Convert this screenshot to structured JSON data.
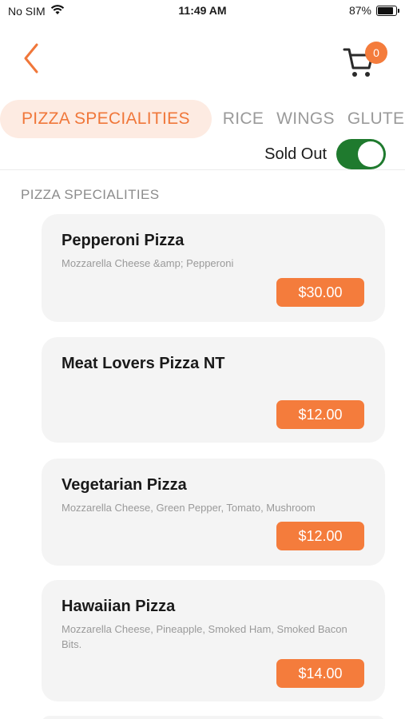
{
  "status_bar": {
    "carrier": "No SIM",
    "time": "11:49 AM",
    "battery_percent": "87%",
    "battery_level": 0.87
  },
  "nav": {
    "back_icon": "chevron-left-icon",
    "cart_icon": "shopping-cart-icon",
    "cart_count": "0"
  },
  "tabs": [
    {
      "label": "PIZZA SPECIALITIES",
      "active": true
    },
    {
      "label": "RICE",
      "active": false
    },
    {
      "label": "WINGS",
      "active": false
    },
    {
      "label": "GLUTEN",
      "active": false
    }
  ],
  "sold_out": {
    "label": "Sold Out",
    "enabled": true
  },
  "section": {
    "title": "PIZZA SPECIALITIES"
  },
  "items": [
    {
      "name": "Pepperoni Pizza",
      "description": "Mozzarella Cheese &amp; Pepperoni",
      "price": "$30.00"
    },
    {
      "name": "Meat Lovers Pizza NT",
      "description": "",
      "price": "$12.00"
    },
    {
      "name": "Vegetarian Pizza",
      "description": "Mozzarella Cheese, Green Pepper, Tomato, Mushroom",
      "price": "$12.00"
    },
    {
      "name": "Hawaiian Pizza",
      "description": "Mozzarella Cheese, Pineapple, Smoked Ham, Smoked Bacon Bits.",
      "price": "$14.00"
    }
  ],
  "colors": {
    "accent": "#f47c3c",
    "tab_active_bg": "#fdebe2",
    "toggle_on": "#1f7a2e",
    "card_bg": "#f4f4f4"
  }
}
